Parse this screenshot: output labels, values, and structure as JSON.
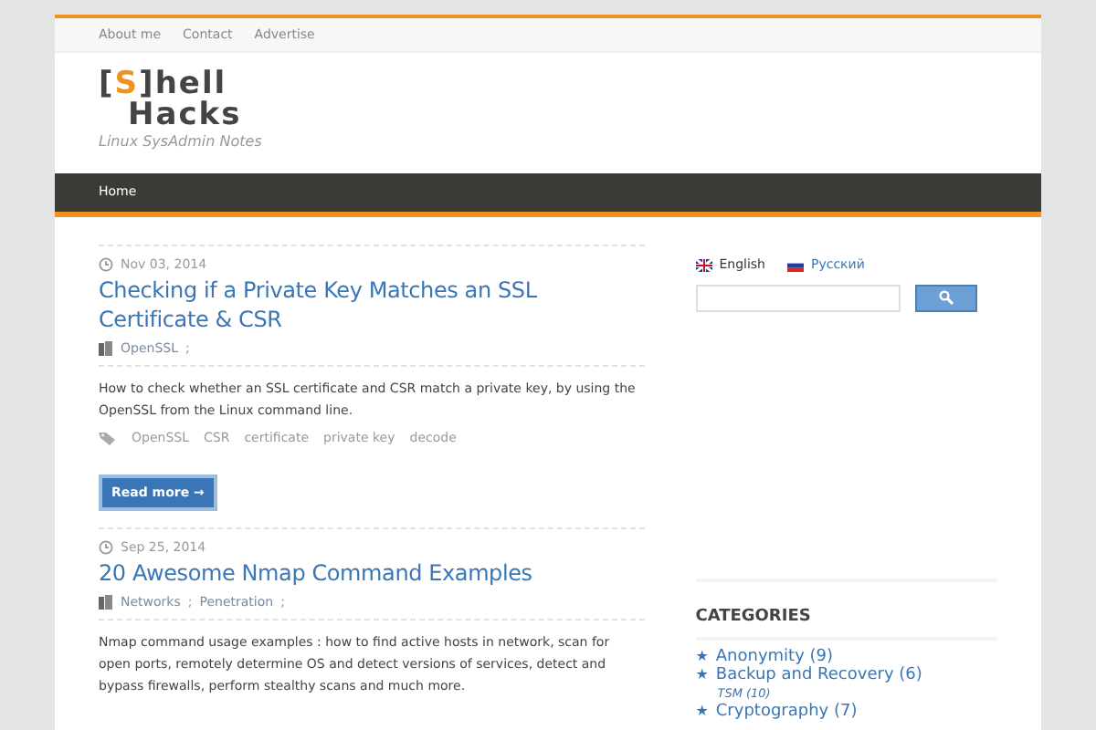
{
  "top_nav": [
    "About me",
    "Contact",
    "Advertise"
  ],
  "logo": {
    "bracket_open": "[",
    "letter": "S",
    "bracket_close": "]",
    "line1": "hell",
    "line2": "Hacks",
    "tagline": "Linux SysAdmin Notes"
  },
  "main_nav": [
    {
      "label": "Home",
      "selected": true
    }
  ],
  "posts": [
    {
      "date": "Nov 03, 2014",
      "category_separator": ";",
      "title": "Checking if a Private Key Matches an SSL Certificate & CSR",
      "categories": [
        "OpenSSL"
      ],
      "excerpt": "How to check whether an SSL certificate and CSR match a private key, by using the OpenSSL from the Linux command line.",
      "tags": [
        "OpenSSL",
        "CSR",
        "certificate",
        "private key",
        "decode"
      ],
      "read_more": "Read more →"
    },
    {
      "date": "Sep 25, 2014",
      "category_separator": ";",
      "title": "20 Awesome Nmap Command Examples",
      "categories": [
        "Networks",
        "Penetration"
      ],
      "excerpt": "Nmap command usage examples : how to find active hosts in network, scan for open ports, remotely determine OS and detect versions of services, detect and bypass firewalls, perform stealthy scans and much more."
    }
  ],
  "languages": [
    {
      "label": "English",
      "selected": true,
      "kind": "uk"
    },
    {
      "label": "Русский",
      "selected": false,
      "kind": "ru"
    }
  ],
  "categories": {
    "title": "CATEGORIES",
    "bullet": "★",
    "items": [
      {
        "label": "Anonymity (9)"
      },
      {
        "label": "Backup and Recovery (6)",
        "children": [
          {
            "label": "TSM (10)"
          }
        ]
      },
      {
        "label": "Cryptography (7)"
      }
    ]
  }
}
